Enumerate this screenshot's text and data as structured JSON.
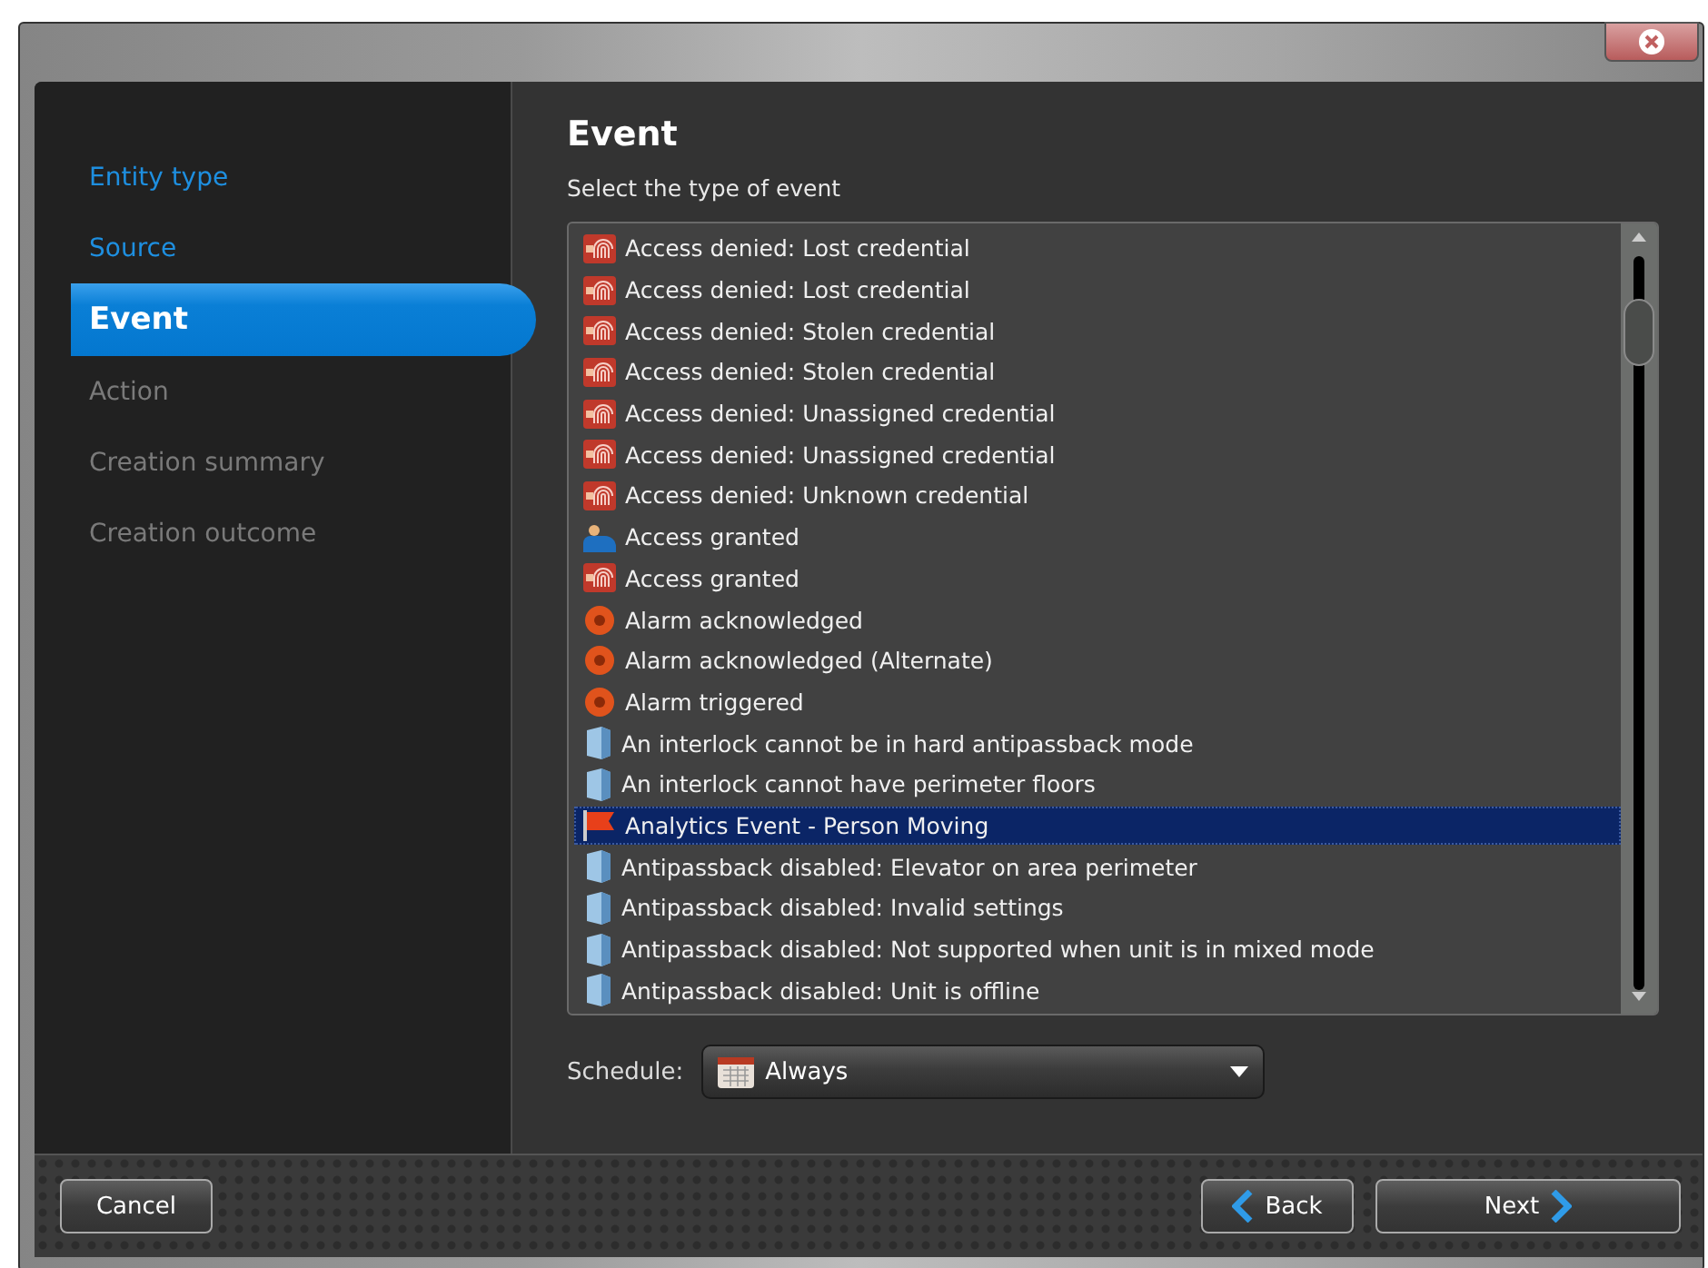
{
  "steps": [
    {
      "label": "Entity type",
      "selected": false,
      "visited": true
    },
    {
      "label": "Source",
      "selected": false,
      "visited": true
    },
    {
      "label": "Event",
      "selected": true,
      "visited": true
    },
    {
      "label": "Action",
      "selected": false,
      "visited": false
    },
    {
      "label": "Creation summary",
      "selected": false,
      "visited": false
    },
    {
      "label": "Creation outcome",
      "selected": false,
      "visited": false
    }
  ],
  "page": {
    "title": "Event",
    "prompt": "Select the type of event"
  },
  "events": [
    {
      "label": "Access denied: Lost credential",
      "kind": "denied",
      "selected": false
    },
    {
      "label": "Access denied: Lost credential",
      "kind": "denied",
      "selected": false
    },
    {
      "label": "Access denied: Stolen credential",
      "kind": "denied",
      "selected": false
    },
    {
      "label": "Access denied: Stolen credential",
      "kind": "denied",
      "selected": false
    },
    {
      "label": "Access denied: Unassigned credential",
      "kind": "denied",
      "selected": false
    },
    {
      "label": "Access denied: Unassigned credential",
      "kind": "denied",
      "selected": false
    },
    {
      "label": "Access denied: Unknown credential",
      "kind": "denied",
      "selected": false
    },
    {
      "label": "Access granted",
      "kind": "person",
      "selected": false
    },
    {
      "label": "Access granted",
      "kind": "denied",
      "selected": false
    },
    {
      "label": "Alarm acknowledged",
      "kind": "alarm",
      "selected": false
    },
    {
      "label": "Alarm acknowledged (Alternate)",
      "kind": "alarm",
      "selected": false
    },
    {
      "label": "Alarm triggered",
      "kind": "alarm",
      "selected": false
    },
    {
      "label": "An interlock cannot be in hard antipassback mode",
      "kind": "unit",
      "selected": false
    },
    {
      "label": "An interlock cannot have perimeter floors",
      "kind": "unit",
      "selected": false
    },
    {
      "label": "Analytics Event - Person Moving",
      "kind": "flag",
      "selected": true
    },
    {
      "label": "Antipassback disabled: Elevator on area perimeter",
      "kind": "unit",
      "selected": false
    },
    {
      "label": "Antipassback disabled: Invalid settings",
      "kind": "unit",
      "selected": false
    },
    {
      "label": "Antipassback disabled: Not supported when unit is in mixed mode",
      "kind": "unit",
      "selected": false
    },
    {
      "label": "Antipassback disabled: Unit is offline",
      "kind": "unit",
      "selected": false
    }
  ],
  "schedule": {
    "label": "Schedule:",
    "value": "Always"
  },
  "buttons": {
    "cancel": "Cancel",
    "back": "Back",
    "next": "Next"
  }
}
